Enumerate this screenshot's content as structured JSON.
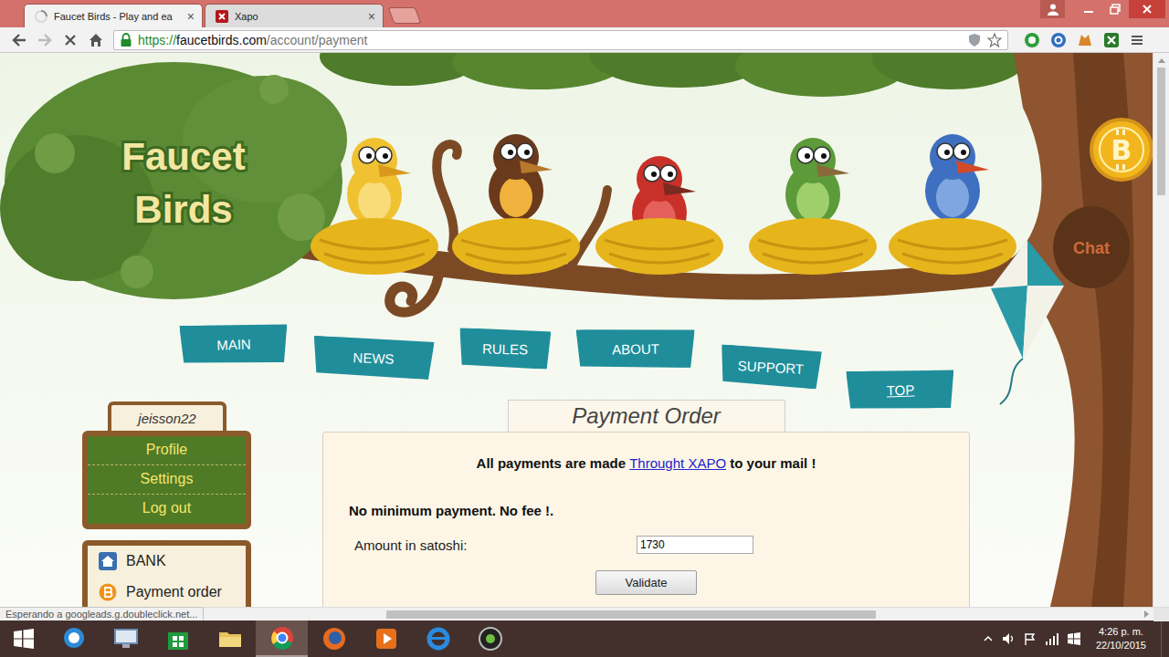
{
  "browser": {
    "tabs": [
      {
        "label": "Faucet Birds - Play and ea",
        "selected": true,
        "loading": true,
        "color": "#8a8f96"
      },
      {
        "label": "Xapo",
        "selected": false,
        "loading": false,
        "color": "#b5161b"
      }
    ],
    "close_glyph": "×",
    "address": {
      "scheme": "https://",
      "host": "faucetbirds.com",
      "path": "/account/payment"
    },
    "page_loading": true,
    "status": "Esperando a googleads.g.doubleclick.net..."
  },
  "site": {
    "logo": [
      "Faucet",
      "Birds"
    ],
    "coin": "B",
    "chat": "Chat",
    "nav": [
      {
        "label": "MAIN",
        "hovered": false
      },
      {
        "label": "NEWS",
        "hovered": false
      },
      {
        "label": "RULES",
        "hovered": false
      },
      {
        "label": "ABOUT",
        "hovered": false
      },
      {
        "label": "SUPPORT",
        "hovered": false
      },
      {
        "label": "TOP",
        "hovered": true
      }
    ],
    "user": {
      "name": "jeisson22",
      "menu": [
        "Profile",
        "Settings",
        "Log out"
      ]
    },
    "bank_menu": [
      "BANK",
      "Payment order"
    ],
    "payment": {
      "title": "Payment Order",
      "lead_before": "All payments are made",
      "link": "Throught XAPO",
      "lead_after": "to your mail !",
      "terms": "No minimum payment. No fee !.",
      "amount_label": "Amount in satoshi:",
      "amount": "1730",
      "button": "Validate"
    }
  },
  "scrollbars": {
    "vertical": {
      "level": 0.23
    },
    "horizontal": {
      "level": 0.436
    }
  },
  "taskbar": {
    "time": "4:26 p. m.",
    "date": "22/10/2015"
  }
}
